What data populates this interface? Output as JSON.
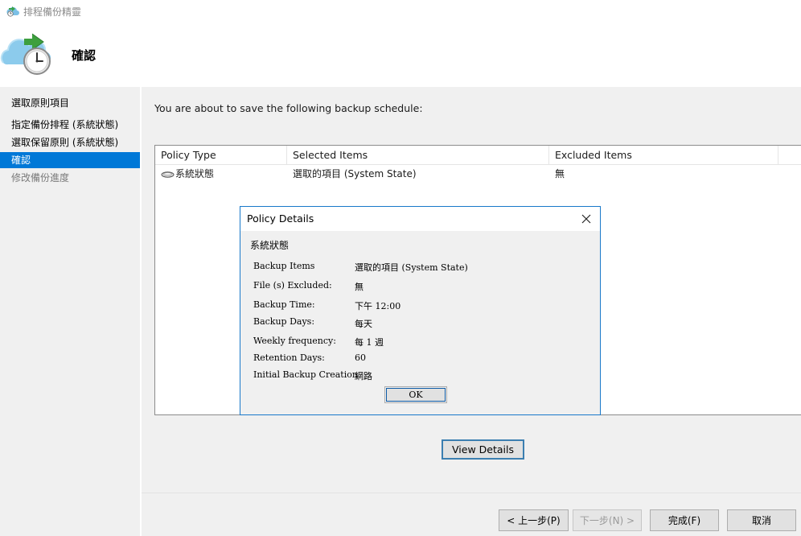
{
  "window": {
    "title": "排程備份精靈"
  },
  "header": {
    "title": "確認"
  },
  "nav": {
    "items": [
      {
        "label": "選取原則項目"
      },
      {
        "label": "指定備份排程 (系統狀態)"
      },
      {
        "label": "選取保留原則 (系統狀態)"
      },
      {
        "label": "確認"
      },
      {
        "label": "修改備份進度"
      }
    ]
  },
  "main": {
    "intro": "You are about to save the following backup schedule:",
    "table": {
      "columns": [
        "Policy Type",
        "Selected Items",
        "Excluded Items"
      ],
      "rows": [
        {
          "policy_type": "系統狀態",
          "selected_items": "選取的項目 (System State)",
          "excluded_items": "無"
        }
      ]
    },
    "view_details_label": "View Details"
  },
  "dialog": {
    "title": "Policy Details",
    "section": "系統狀態",
    "fields": [
      {
        "label": "Backup Items",
        "value": "選取的項目 (System State)"
      },
      {
        "label": "File (s) Excluded:",
        "value": "無"
      },
      {
        "label": "Backup Time:",
        "value": "下午 12:00"
      },
      {
        "label": "Backup Days:",
        "value": "每天"
      },
      {
        "label": "Weekly frequency:",
        "value": "每 1 週"
      },
      {
        "label": "Retention Days:",
        "value": "60"
      },
      {
        "label": "Initial Backup Creation",
        "value": "網路"
      }
    ],
    "ok_label": "OK"
  },
  "footer": {
    "back_label": "< 上一步(P)",
    "next_label": "下一步(N) >",
    "finish_label": "完成(F)",
    "cancel_label": "取消"
  },
  "colors": {
    "accent": "#0078d7",
    "dialog_border": "#1979ca"
  }
}
